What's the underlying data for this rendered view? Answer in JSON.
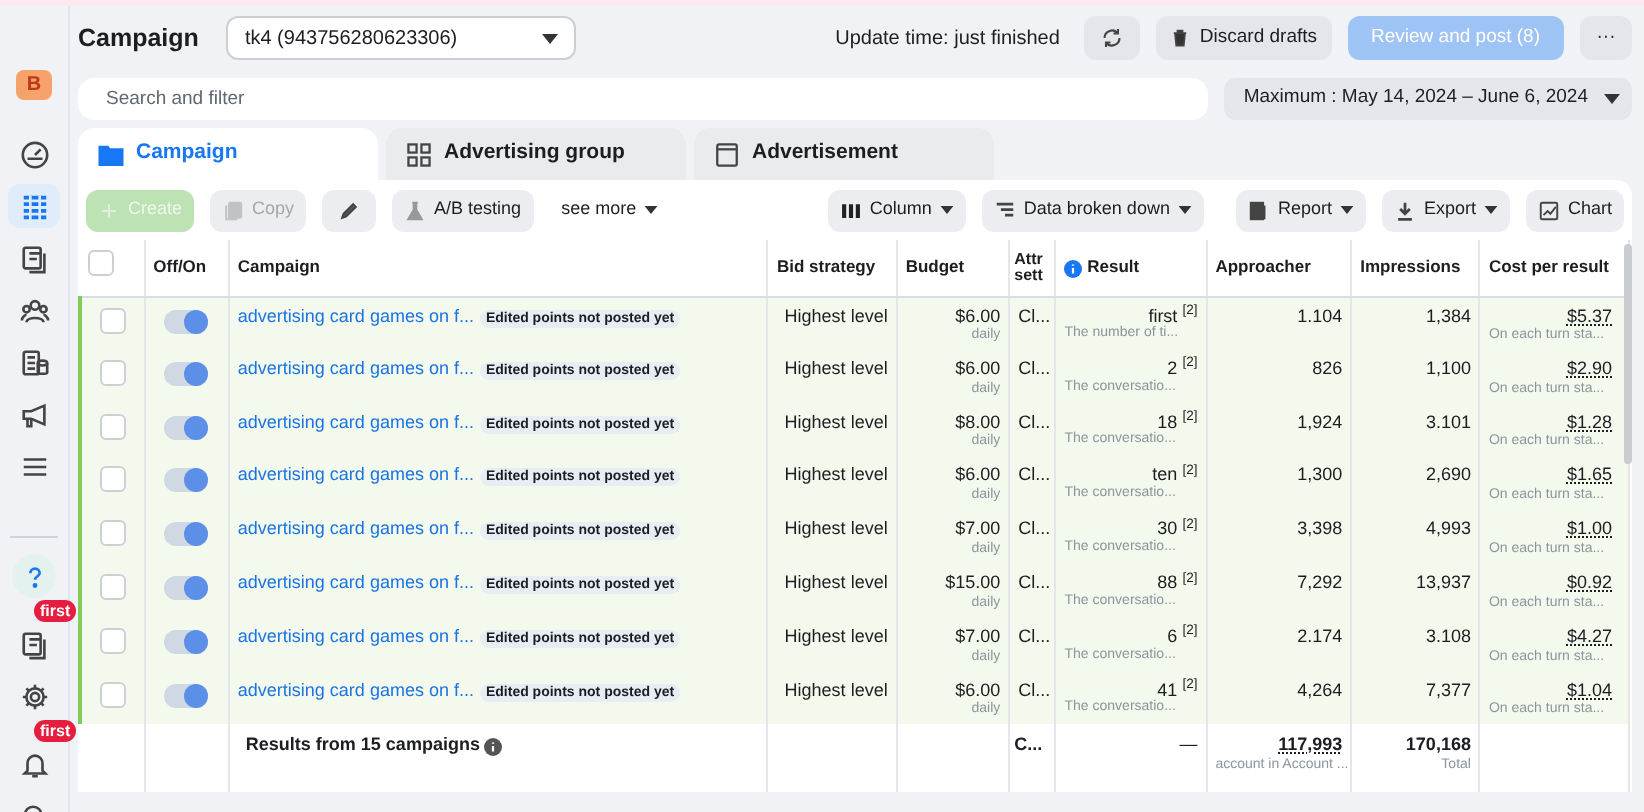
{
  "sidebar": {
    "avatar": "B",
    "items": [
      {
        "kind": "gauge",
        "selected": false
      },
      {
        "kind": "grid",
        "selected": true
      },
      {
        "kind": "pages",
        "selected": false
      },
      {
        "kind": "people",
        "selected": false
      },
      {
        "kind": "coins",
        "selected": false
      },
      {
        "kind": "megaphone",
        "selected": false
      },
      {
        "kind": "menu",
        "selected": false
      }
    ],
    "bottom_items": [
      {
        "kind": "help",
        "selected": false
      },
      {
        "kind": "pages",
        "selected": false,
        "badge": "first"
      },
      {
        "kind": "gear",
        "selected": false
      },
      {
        "kind": "bell",
        "selected": false,
        "badge": "first"
      },
      {
        "kind": "search",
        "selected": false
      }
    ]
  },
  "header": {
    "title": "Campaign",
    "account": "tk4 (943756280623306)",
    "update_time": "Update time: just finished",
    "discard": "Discard drafts",
    "review": "Review and post (8)",
    "more": "···"
  },
  "search": {
    "placeholder": "Search and filter",
    "date_range": "Maximum : May 14, 2024 – June 6, 2024"
  },
  "tabs": [
    {
      "label": "Campaign",
      "kind": "folder",
      "selected": true
    },
    {
      "label": "Advertising group",
      "kind": "group",
      "selected": false
    },
    {
      "label": "Advertisement",
      "kind": "ad",
      "selected": false
    }
  ],
  "toolbar": [
    {
      "label": "Create",
      "kind": "create",
      "disabled": true
    },
    {
      "label": "Copy",
      "kind": "copy",
      "disabled": true
    },
    {
      "kind": "edit",
      "disabled": false
    },
    {
      "label": "A/B testing",
      "kind": "flask",
      "disabled": false
    },
    {
      "label": "see more",
      "kind": "more",
      "disabled": false
    },
    {
      "label": "Column",
      "kind": "column",
      "disabled": false
    },
    {
      "label": "Data broken down",
      "kind": "breakdown",
      "disabled": false
    },
    {
      "label": "Report",
      "kind": "report",
      "disabled": false
    },
    {
      "label": "Export",
      "kind": "export",
      "disabled": false
    },
    {
      "label": "Chart",
      "kind": "chart",
      "disabled": false
    }
  ],
  "table": {
    "select_all_checked": false,
    "columns": [
      "Off/On",
      "Campaign",
      "Bid strategy",
      "Budget",
      "Attr sett",
      "Result",
      "Approacher",
      "Impressions",
      "Cost per result"
    ],
    "rows": [
      {
        "checked": false,
        "on": true,
        "campaign": "advertising card games on f...",
        "tag": "Edited points not posted yet",
        "bid": "Highest level",
        "budget": "$6.00",
        "budget_note": "daily",
        "attr": "Cl...",
        "result": "first $^{[2]}$",
        "result_note": "The number of ti...",
        "approacher": "1.104",
        "impressions": "1,384",
        "cost": "$5.37",
        "cost_note": "On each turn sta..."
      },
      {
        "checked": false,
        "on": true,
        "campaign": "advertising card games on f...",
        "tag": "Edited points not posted yet",
        "bid": "Highest level",
        "budget": "$6.00",
        "budget_note": "daily",
        "attr": "Cl...",
        "result": "2 $^{[2]}$",
        "result_note": "The conversatio...",
        "approacher": "826",
        "impressions": "1,100",
        "cost": "$2.90",
        "cost_note": "On each turn sta..."
      },
      {
        "checked": false,
        "on": true,
        "campaign": "advertising card games on f...",
        "tag": "Edited points not posted yet",
        "bid": "Highest level",
        "budget": "$8.00",
        "budget_note": "daily",
        "attr": "Cl...",
        "result": "18 $^{[2]}$",
        "result_note": "The conversatio...",
        "approacher": "1,924",
        "impressions": "3.101",
        "cost": "$1.28",
        "cost_note": "On each turn sta..."
      },
      {
        "checked": false,
        "on": true,
        "campaign": "advertising card games on f...",
        "tag": "Edited points not posted yet",
        "bid": "Highest level",
        "budget": "$6.00",
        "budget_note": "daily",
        "attr": "Cl...",
        "result": "ten $^{[2]}$",
        "result_note": "The conversatio...",
        "approacher": "1,300",
        "impressions": "2,690",
        "cost": "$1.65",
        "cost_note": "On each turn sta..."
      },
      {
        "checked": false,
        "on": true,
        "campaign": "advertising card games on f...",
        "tag": "Edited points not posted yet",
        "bid": "Highest level",
        "budget": "$7.00",
        "budget_note": "daily",
        "attr": "Cl...",
        "result": "30 $^{[2]}$",
        "result_note": "The conversatio...",
        "approacher": "3,398",
        "impressions": "4,993",
        "cost": "$1.00",
        "cost_note": "On each turn sta..."
      },
      {
        "checked": false,
        "on": true,
        "campaign": "advertising card games on f...",
        "tag": "Edited points not posted yet",
        "bid": "Highest level",
        "budget": "$15.00",
        "budget_note": "daily",
        "attr": "Cl...",
        "result": "88 $^{[2]}$",
        "result_note": "The conversatio...",
        "approacher": "7,292",
        "impressions": "13,937",
        "cost": "$0.92",
        "cost_note": "On each turn sta..."
      },
      {
        "checked": false,
        "on": true,
        "campaign": "advertising card games on f...",
        "tag": "Edited points not posted yet",
        "bid": "Highest level",
        "budget": "$7.00",
        "budget_note": "daily",
        "attr": "Cl...",
        "result": "6 $^{[2]}$",
        "result_note": "The conversatio...",
        "approacher": "2.174",
        "impressions": "3.108",
        "cost": "$4.27",
        "cost_note": "On each turn sta..."
      },
      {
        "checked": false,
        "on": true,
        "campaign": "advertising card games on f...",
        "tag": "Edited points not posted yet",
        "bid": "Highest level",
        "budget": "$6.00",
        "budget_note": "daily",
        "attr": "Cl...",
        "result": "41 $^{[2]}$",
        "result_note": "The conversatio...",
        "approacher": "4,264",
        "impressions": "7,377",
        "cost": "$1.04",
        "cost_note": "On each turn sta..."
      }
    ],
    "footer": {
      "campaign": "Results from 15 campaigns",
      "attr": "C...",
      "result": "—",
      "approacher": "117,993",
      "approacher_note": "account in Account ...",
      "impressions": "170,168",
      "impressions_note": "Total"
    }
  }
}
